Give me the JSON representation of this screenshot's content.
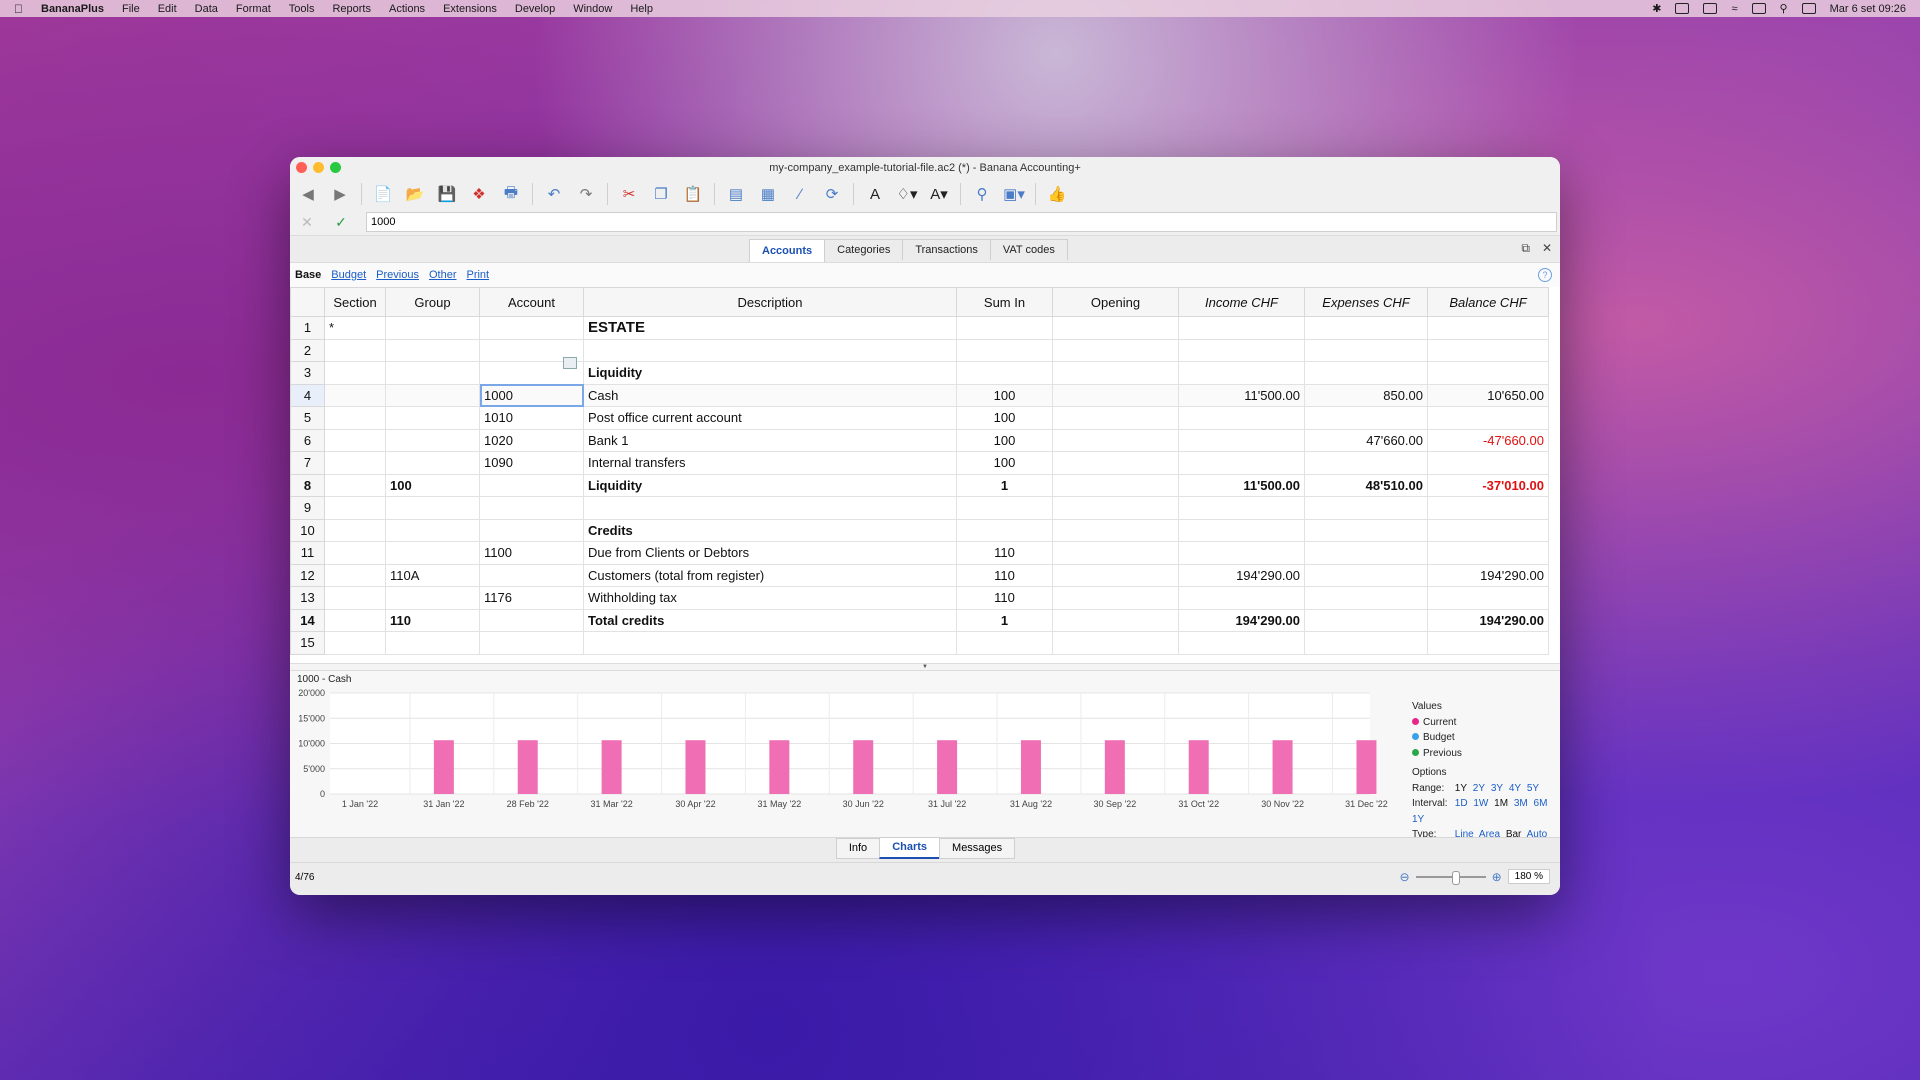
{
  "menubar": {
    "app": "BananaPlus",
    "items": [
      "File",
      "Edit",
      "Data",
      "Format",
      "Tools",
      "Reports",
      "Actions",
      "Extensions",
      "Develop",
      "Window",
      "Help"
    ],
    "datetime": "Mar 6 set  09:26"
  },
  "window": {
    "title": "my-company_example-tutorial-file.ac2 (*) - Banana Accounting+"
  },
  "formula": {
    "value": "1000"
  },
  "tabs": [
    "Accounts",
    "Categories",
    "Transactions",
    "VAT codes"
  ],
  "views": {
    "base": "Base",
    "links": [
      "Budget",
      "Previous",
      "Other",
      "Print"
    ]
  },
  "table": {
    "headers": [
      "Section",
      "Group",
      "Account",
      "Description",
      "Sum In",
      "Opening",
      "Income CHF",
      "Expenses CHF",
      "Balance CHF"
    ],
    "rows": [
      {
        "n": "1",
        "section": "*",
        "group": "",
        "account": "",
        "desc": "ESTATE",
        "sumin": "",
        "opening": "",
        "income": "",
        "expenses": "",
        "balance": ""
      },
      {
        "n": "2",
        "section": "",
        "group": "",
        "account": "",
        "desc": "",
        "sumin": "",
        "opening": "",
        "income": "",
        "expenses": "",
        "balance": ""
      },
      {
        "n": "3",
        "section": "",
        "group": "",
        "account": "",
        "desc": "Liquidity",
        "sumin": "",
        "opening": "",
        "income": "",
        "expenses": "",
        "balance": ""
      },
      {
        "n": "4",
        "section": "",
        "group": "",
        "account": "1000",
        "desc": "Cash",
        "sumin": "100",
        "opening": "",
        "income": "11'500.00",
        "expenses": "850.00",
        "balance": "10'650.00"
      },
      {
        "n": "5",
        "section": "",
        "group": "",
        "account": "1010",
        "desc": "Post office current account",
        "sumin": "100",
        "opening": "",
        "income": "",
        "expenses": "",
        "balance": ""
      },
      {
        "n": "6",
        "section": "",
        "group": "",
        "account": "1020",
        "desc": "Bank 1",
        "sumin": "100",
        "opening": "",
        "income": "",
        "expenses": "47'660.00",
        "balance": "-47'660.00"
      },
      {
        "n": "7",
        "section": "",
        "group": "",
        "account": "1090",
        "desc": "Internal transfers",
        "sumin": "100",
        "opening": "",
        "income": "",
        "expenses": "",
        "balance": ""
      },
      {
        "n": "8",
        "section": "",
        "group": "100",
        "account": "",
        "desc": "Liquidity",
        "sumin": "1",
        "opening": "",
        "income": "11'500.00",
        "expenses": "48'510.00",
        "balance": "-37'010.00"
      },
      {
        "n": "9",
        "section": "",
        "group": "",
        "account": "",
        "desc": "",
        "sumin": "",
        "opening": "",
        "income": "",
        "expenses": "",
        "balance": ""
      },
      {
        "n": "10",
        "section": "",
        "group": "",
        "account": "",
        "desc": "Credits",
        "sumin": "",
        "opening": "",
        "income": "",
        "expenses": "",
        "balance": ""
      },
      {
        "n": "11",
        "section": "",
        "group": "",
        "account": "1100",
        "desc": "Due from Clients or Debtors",
        "sumin": "110",
        "opening": "",
        "income": "",
        "expenses": "",
        "balance": ""
      },
      {
        "n": "12",
        "section": "",
        "group": "110A",
        "account": "",
        "desc": "Customers (total from register)",
        "sumin": "110",
        "opening": "",
        "income": "194'290.00",
        "expenses": "",
        "balance": "194'290.00"
      },
      {
        "n": "13",
        "section": "",
        "group": "",
        "account": "1176",
        "desc": "Withholding tax",
        "sumin": "110",
        "opening": "",
        "income": "",
        "expenses": "",
        "balance": ""
      },
      {
        "n": "14",
        "section": "",
        "group": "110",
        "account": "",
        "desc": "Total credits",
        "sumin": "1",
        "opening": "",
        "income": "194'290.00",
        "expenses": "",
        "balance": "194'290.00"
      },
      {
        "n": "15",
        "section": "",
        "group": "",
        "account": "",
        "desc": "",
        "sumin": "",
        "opening": "",
        "income": "",
        "expenses": "",
        "balance": ""
      }
    ]
  },
  "chart_data": {
    "type": "bar",
    "title": "1000 - Cash",
    "categories": [
      "1 Jan '22",
      "31 Jan '22",
      "28 Feb '22",
      "31 Mar '22",
      "30 Apr '22",
      "31 May '22",
      "30 Jun '22",
      "31 Jul '22",
      "31 Aug '22",
      "30 Sep '22",
      "31 Oct '22",
      "30 Nov '22",
      "31 Dec '22"
    ],
    "series": [
      {
        "name": "Current",
        "values": [
          0,
          10650,
          10650,
          10650,
          10650,
          10650,
          10650,
          10650,
          10650,
          10650,
          10650,
          10650,
          10650
        ]
      }
    ],
    "ylim": [
      0,
      20000
    ],
    "yticks": [
      "0",
      "5'000",
      "10'000",
      "15'000",
      "20'000"
    ],
    "bar_color": "#f06fb4",
    "legend": {
      "values_label": "Values",
      "items": [
        {
          "label": "Current",
          "color": "#e8268a"
        },
        {
          "label": "Budget",
          "color": "#3aa0e8"
        },
        {
          "label": "Previous",
          "color": "#2aa74a"
        }
      ],
      "options_label": "Options",
      "range_label": "Range:",
      "range": [
        "1Y",
        "2Y",
        "3Y",
        "4Y",
        "5Y"
      ],
      "interval_label": "Interval:",
      "interval": [
        "1D",
        "1W",
        "1M",
        "3M",
        "6M",
        "1Y"
      ],
      "type_label": "Type:",
      "types": [
        "Line",
        "Area",
        "Bar",
        "Auto"
      ]
    }
  },
  "bottom_tabs": [
    "Info",
    "Charts",
    "Messages"
  ],
  "status": {
    "position": "4/76",
    "zoom": "180 %"
  }
}
